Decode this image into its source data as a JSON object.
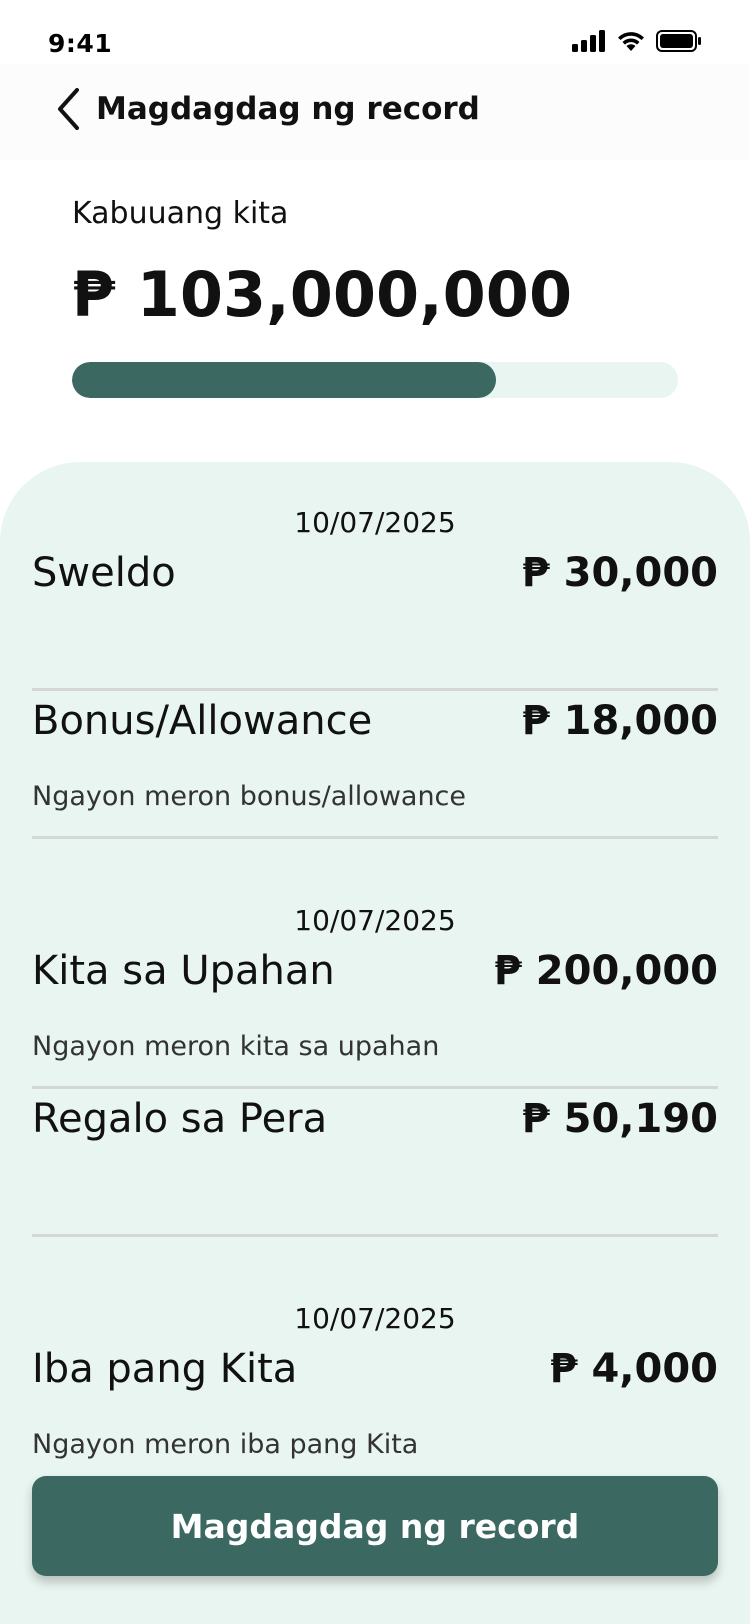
{
  "status_bar": {
    "time": "9:41",
    "icons": [
      "cellular-signal-icon",
      "wifi-icon",
      "battery-icon"
    ]
  },
  "header": {
    "back_icon": "chevron-left-icon",
    "title": "Magdagdag ng record"
  },
  "summary": {
    "label": "Kabuuang kita",
    "amount": "₱ 103,000,000",
    "progress_fraction": 0.7
  },
  "groups": [
    {
      "date": "10/07/2025",
      "items": [
        {
          "title": "Sweldo",
          "amount": "₱ 30,000",
          "note": ""
        },
        {
          "title": "Bonus/Allowance",
          "amount": "₱ 18,000",
          "note": "Ngayon meron bonus/allowance"
        }
      ]
    },
    {
      "date": "10/07/2025",
      "items": [
        {
          "title": "Kita sa Upahan",
          "amount": "₱ 200,000",
          "note": "Ngayon meron kita sa upahan"
        },
        {
          "title": "Regalo sa Pera",
          "amount": "₱ 50,190",
          "note": ""
        }
      ]
    },
    {
      "date": "10/07/2025",
      "items": [
        {
          "title": "Iba pang Kita",
          "amount": "₱ 4,000",
          "note": "Ngayon meron iba pang Kita"
        }
      ]
    }
  ],
  "primary_button": {
    "label": "Magdagdag ng record"
  },
  "colors": {
    "accent": "#3b6861",
    "sheet_background": "#e9f5f1",
    "progress_track": "#e9f5f1",
    "divider": "#d3d8d6"
  }
}
